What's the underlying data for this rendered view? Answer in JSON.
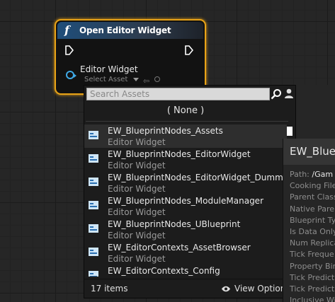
{
  "node": {
    "title": "Open Editor Widget",
    "function_glyph": "f",
    "pin_label": "Editor Widget",
    "select_placeholder": "Select Asset",
    "accent_color": "#e8a317",
    "pin_color": "#3fa9e6"
  },
  "picker": {
    "search_placeholder": "Search Assets",
    "none_label": "( None )",
    "items": [
      {
        "name": "EW_BlueprintNodes_Assets",
        "type": "Editor Widget"
      },
      {
        "name": "EW_BlueprintNodes_EditorWidget",
        "type": "Editor Widget"
      },
      {
        "name": "EW_BlueprintNodes_EditorWidget_Dummy",
        "type": "Editor Widget"
      },
      {
        "name": "EW_BlueprintNodes_ModuleManager",
        "type": "Editor Widget"
      },
      {
        "name": "EW_BlueprintNodes_UBlueprint",
        "type": "Editor Widget"
      },
      {
        "name": "EW_EditorContexts_AssetBrowser",
        "type": "Editor Widget"
      },
      {
        "name": "EW_EditorContexts_Config",
        "type": "Editor Widget"
      }
    ],
    "count_label": "17 items",
    "view_options_label": "View Option"
  },
  "tooltip": {
    "title": "EW_Bluep",
    "path_label": "Path:",
    "path_value": "/Gam",
    "rows": [
      "Cooking File",
      "Parent Class",
      "Native Paren",
      "Blueprint Ty",
      "Is Data Only",
      "Num Replica",
      "Tick Freque",
      "Property Bin",
      "Tick Predicti",
      "Tick Predicti",
      "Inclusive Wi"
    ]
  }
}
